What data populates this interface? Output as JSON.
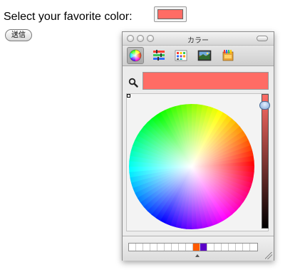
{
  "form": {
    "label": "Select your favorite color:",
    "selected_color": "#ff6c65",
    "submit_label": "送信"
  },
  "panel": {
    "title": "カラー",
    "current_color": "#ff6c65",
    "toolbar": [
      {
        "name": "color-wheel-tool-icon",
        "selected": true
      },
      {
        "name": "color-sliders-tool-icon",
        "selected": false
      },
      {
        "name": "color-palettes-tool-icon",
        "selected": false
      },
      {
        "name": "image-palettes-tool-icon",
        "selected": false
      },
      {
        "name": "crayons-tool-icon",
        "selected": false
      }
    ],
    "wheel_selection": {
      "hue": 0,
      "saturation": 0.6
    },
    "brightness": 0.92,
    "swatches": [
      "#ffffff",
      "#ffffff",
      "#ffffff",
      "#ffffff",
      "#ffffff",
      "#ffffff",
      "#ffffff",
      "#ffffff",
      "#ffffff",
      "#ff5a00",
      "#5c00c8",
      "#ffffff",
      "#ffffff",
      "#ffffff",
      "#ffffff",
      "#ffffff",
      "#ffffff",
      "#ffffff"
    ]
  }
}
